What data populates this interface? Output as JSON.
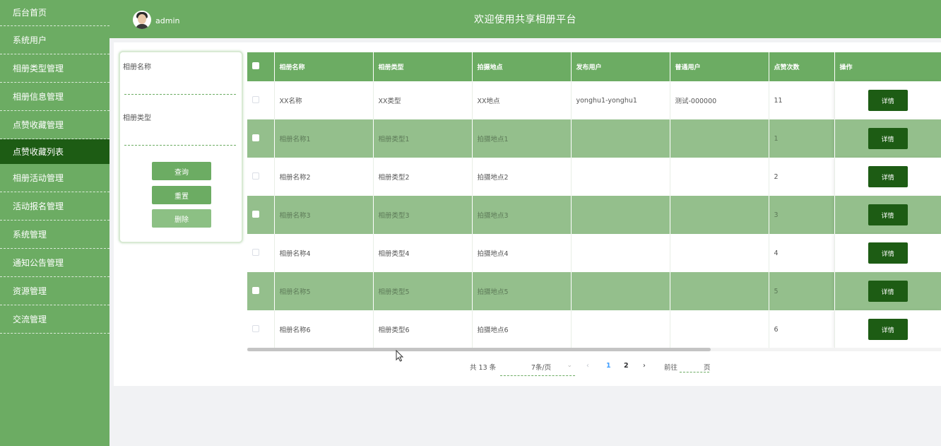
{
  "sidebar": {
    "items": [
      {
        "label": "后台首页"
      },
      {
        "label": "系统用户"
      },
      {
        "label": "相册类型管理"
      },
      {
        "label": "相册信息管理"
      },
      {
        "label": "点赞收藏管理"
      },
      {
        "label": "点赞收藏列表"
      },
      {
        "label": "相册活动管理"
      },
      {
        "label": "活动报名管理"
      },
      {
        "label": "系统管理"
      },
      {
        "label": "通知公告管理"
      },
      {
        "label": "资源管理"
      },
      {
        "label": "交流管理"
      }
    ],
    "active_index": 5
  },
  "header": {
    "username": "admin",
    "title": "欢迎使用共享相册平台"
  },
  "search": {
    "album_name_label": "相册名称",
    "album_name_value": "",
    "album_type_label": "相册类型",
    "album_type_value": "",
    "query_label": "查询",
    "reset_label": "重置",
    "delete_label": "删除"
  },
  "table": {
    "columns": [
      "相册名称",
      "相册类型",
      "拍摄地点",
      "发布用户",
      "普通用户",
      "点赞次数",
      "操作"
    ],
    "rows": [
      {
        "name": "XX名称",
        "type": "XX类型",
        "location": "XX地点",
        "publisher": "yonghu1-yonghu1",
        "user": "测试-000000",
        "likes": "11",
        "action": "详情"
      },
      {
        "name": "相册名称1",
        "type": "相册类型1",
        "location": "拍摄地点1",
        "publisher": "",
        "user": "",
        "likes": "1",
        "action": "详情"
      },
      {
        "name": "相册名称2",
        "type": "相册类型2",
        "location": "拍摄地点2",
        "publisher": "",
        "user": "",
        "likes": "2",
        "action": "详情"
      },
      {
        "name": "相册名称3",
        "type": "相册类型3",
        "location": "拍摄地点3",
        "publisher": "",
        "user": "",
        "likes": "3",
        "action": "详情"
      },
      {
        "name": "相册名称4",
        "type": "相册类型4",
        "location": "拍摄地点4",
        "publisher": "",
        "user": "",
        "likes": "4",
        "action": "详情"
      },
      {
        "name": "相册名称5",
        "type": "相册类型5",
        "location": "拍摄地点5",
        "publisher": "",
        "user": "",
        "likes": "5",
        "action": "详情"
      },
      {
        "name": "相册名称6",
        "type": "相册类型6",
        "location": "拍摄地点6",
        "publisher": "",
        "user": "",
        "likes": "6",
        "action": "详情"
      }
    ]
  },
  "pagination": {
    "total_text": "共 13 条",
    "page_size": "7条/页",
    "prev": "‹",
    "pages": [
      "1",
      "2"
    ],
    "current": "1",
    "next": "›",
    "goto_label": "前往",
    "goto_value": "",
    "page_suffix": "页"
  },
  "colors": {
    "primary": "#6cac63",
    "dark": "#1d5c14",
    "row_alt": "#94bf8c"
  },
  "icons": {
    "avatar": "user-avatar-icon",
    "checkbox": "checkbox-icon",
    "select_arrow": "chevron-down-icon",
    "cursor": "mouse-pointer-icon"
  }
}
